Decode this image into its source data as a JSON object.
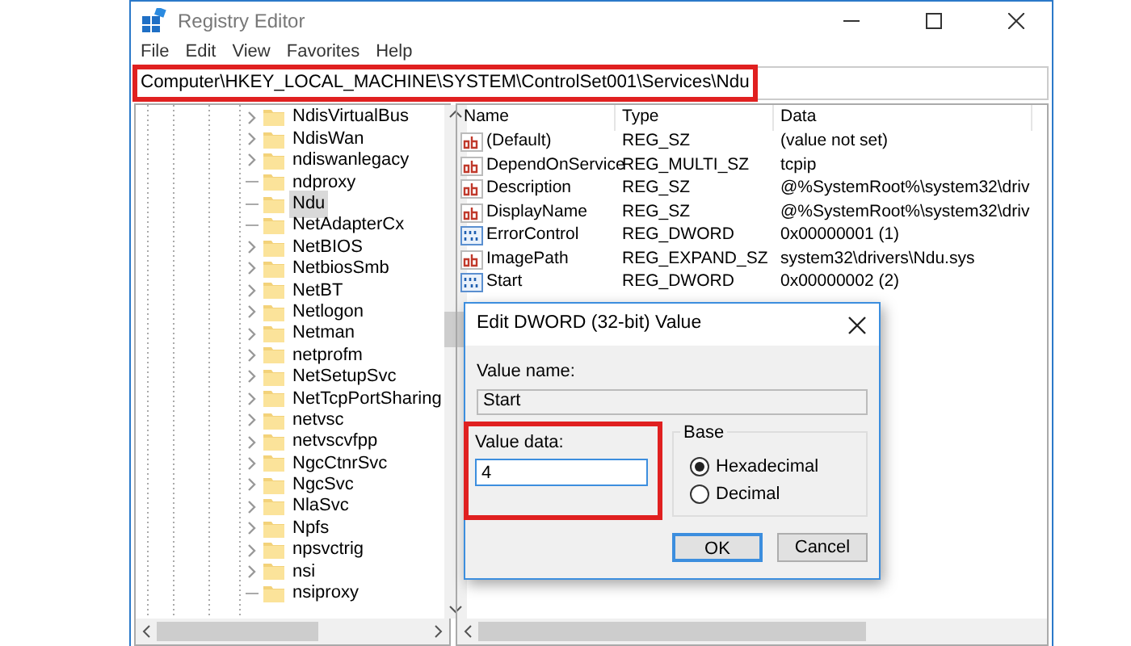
{
  "window": {
    "title": "Registry Editor"
  },
  "menu": [
    "File",
    "Edit",
    "View",
    "Favorites",
    "Help"
  ],
  "address_bar": {
    "path": "Computer\\HKEY_LOCAL_MACHINE\\SYSTEM\\ControlSet001\\Services\\Ndu",
    "highlighted": true
  },
  "tree": [
    {
      "label": "NdisVirtualBus",
      "expandable": true,
      "selected": false
    },
    {
      "label": "NdisWan",
      "expandable": true,
      "selected": false
    },
    {
      "label": "ndiswanlegacy",
      "expandable": true,
      "selected": false
    },
    {
      "label": "ndproxy",
      "expandable": false,
      "selected": false
    },
    {
      "label": "Ndu",
      "expandable": false,
      "selected": true
    },
    {
      "label": "NetAdapterCx",
      "expandable": false,
      "selected": false
    },
    {
      "label": "NetBIOS",
      "expandable": true,
      "selected": false
    },
    {
      "label": "NetbiosSmb",
      "expandable": true,
      "selected": false
    },
    {
      "label": "NetBT",
      "expandable": true,
      "selected": false
    },
    {
      "label": "Netlogon",
      "expandable": true,
      "selected": false
    },
    {
      "label": "Netman",
      "expandable": true,
      "selected": false
    },
    {
      "label": "netprofm",
      "expandable": true,
      "selected": false
    },
    {
      "label": "NetSetupSvc",
      "expandable": true,
      "selected": false
    },
    {
      "label": "NetTcpPortSharing",
      "expandable": true,
      "selected": false
    },
    {
      "label": "netvsc",
      "expandable": true,
      "selected": false
    },
    {
      "label": "netvscvfpp",
      "expandable": true,
      "selected": false
    },
    {
      "label": "NgcCtnrSvc",
      "expandable": true,
      "selected": false
    },
    {
      "label": "NgcSvc",
      "expandable": true,
      "selected": false
    },
    {
      "label": "NlaSvc",
      "expandable": true,
      "selected": false
    },
    {
      "label": "Npfs",
      "expandable": true,
      "selected": false
    },
    {
      "label": "npsvctrig",
      "expandable": true,
      "selected": false
    },
    {
      "label": "nsi",
      "expandable": true,
      "selected": false
    },
    {
      "label": "nsiproxy",
      "expandable": false,
      "selected": false
    }
  ],
  "values": {
    "columns": [
      "Name",
      "Type",
      "Data"
    ],
    "rows": [
      {
        "kind": "string",
        "name": "(Default)",
        "type": "REG_SZ",
        "data": "(value not set)"
      },
      {
        "kind": "string",
        "name": "DependOnService",
        "type": "REG_MULTI_SZ",
        "data": "tcpip"
      },
      {
        "kind": "string",
        "name": "Description",
        "type": "REG_SZ",
        "data": "@%SystemRoot%\\system32\\driv"
      },
      {
        "kind": "string",
        "name": "DisplayName",
        "type": "REG_SZ",
        "data": "@%SystemRoot%\\system32\\driv"
      },
      {
        "kind": "binary",
        "name": "ErrorControl",
        "type": "REG_DWORD",
        "data": "0x00000001 (1)"
      },
      {
        "kind": "string",
        "name": "ImagePath",
        "type": "REG_EXPAND_SZ",
        "data": "system32\\drivers\\Ndu.sys"
      },
      {
        "kind": "binary",
        "name": "Start",
        "type": "REG_DWORD",
        "data": "0x00000002 (2)"
      }
    ]
  },
  "dialog": {
    "title": "Edit DWORD (32-bit) Value",
    "value_name_label": "Value name:",
    "value_name": "Start",
    "value_data_label": "Value data:",
    "value_data": "4",
    "value_data_highlighted": true,
    "base_label": "Base",
    "bases": [
      {
        "label": "Hexadecimal",
        "selected": true
      },
      {
        "label": "Decimal",
        "selected": false
      }
    ],
    "buttons": [
      {
        "label": "OK",
        "default": true
      },
      {
        "label": "Cancel",
        "default": false
      }
    ]
  }
}
